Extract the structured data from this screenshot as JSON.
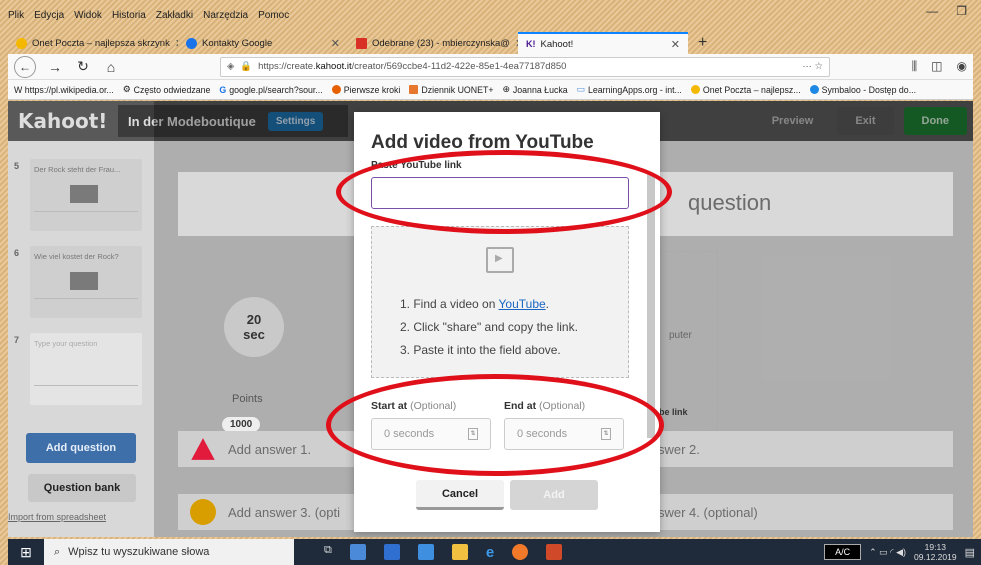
{
  "menubar": [
    "Plik",
    "Edycja",
    "Widok",
    "Historia",
    "Zakładki",
    "Narzędzia",
    "Pomoc"
  ],
  "tabs": [
    {
      "label": "Onet Poczta – najlepsza skrzynk",
      "color": "#f5b800"
    },
    {
      "label": "Kontakty Google",
      "color": "#1a73e8"
    },
    {
      "label": "Odebrane (23) - mbierczynska@",
      "color": "#d93025"
    },
    {
      "label": "Kahoot!",
      "color": "#46178f"
    }
  ],
  "url": {
    "prefix": "https://create.",
    "domain": "kahoot.it",
    "path": "/creator/569ccbe4-11d2-422e-85e1-4ea77187d850"
  },
  "bookmarks": [
    "W https://pl.wikipedia.or...",
    "Często odwiedzane",
    "google.pl/search?sour...",
    "Pierwsze kroki",
    "Dziennik UONET+",
    "Joanna Łucka",
    "LearningApps.org - int...",
    "Onet Poczta – najlepsz...",
    "Symbaloo - Dostęp do..."
  ],
  "app": {
    "logo": "Kahoot!",
    "quiz_title": "In der Modeboutique",
    "settings": "Settings",
    "preview": "Preview",
    "exit": "Exit",
    "done": "Done",
    "slides": [
      {
        "num": "5",
        "title": "Der Rock steht der Frau..."
      },
      {
        "num": "6",
        "title": "Wie viel kostet der Rock?"
      },
      {
        "num": "7",
        "title": "Type your question"
      }
    ],
    "add_question": "Add question",
    "question_bank": "Question bank",
    "import": "Import from spreadsheet",
    "bg_question": "question",
    "timer_value": "20",
    "timer_unit": "sec",
    "points_label": "Points",
    "points_value": "1000",
    "media_text": "puter",
    "media_link": "be link",
    "answers": [
      {
        "text": "Add answer 1.",
        "color": "#e21b3c"
      },
      {
        "text": "swer 2.",
        "color": "#1368ce"
      },
      {
        "text": "Add answer 3. (opti",
        "color": "#d89e00"
      },
      {
        "text": "swer 4. (optional)",
        "color": "#26890c"
      }
    ]
  },
  "modal": {
    "title": "Add video from YouTube",
    "paste_label": "Paste YouTube link",
    "link_value": "",
    "step1_pre": "1. Find a video on ",
    "step1_link": "YouTube",
    "step1_post": ".",
    "step2": "2. Click \"share\" and copy the link.",
    "step3": "3. Paste it into the field above.",
    "start_label": "Start at",
    "end_label": "End at",
    "optional": "(Optional)",
    "start_placeholder": "0 seconds",
    "end_placeholder": "0 seconds",
    "cancel": "Cancel",
    "add": "Add"
  },
  "taskbar": {
    "search_placeholder": "Wpisz tu wyszukiwane słowa",
    "lang": "A/C",
    "time": "19:13",
    "date": "09.12.2019"
  }
}
